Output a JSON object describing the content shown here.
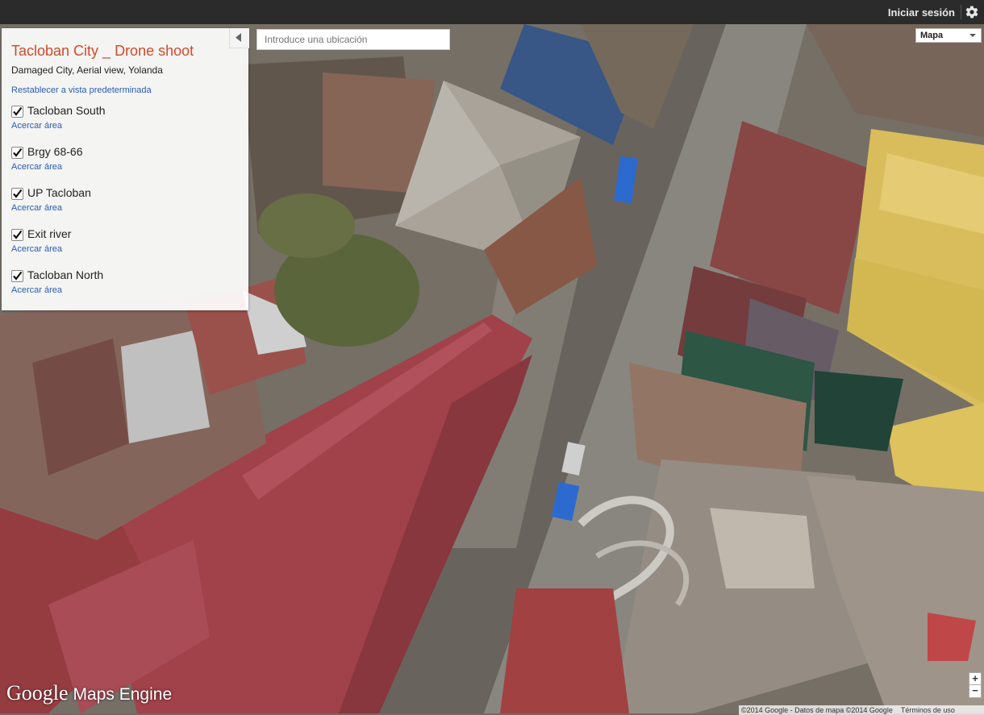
{
  "topbar": {
    "signin_label": "Iniciar sesión",
    "settings_icon": "gear-icon"
  },
  "panel": {
    "title": "Tacloban City _ Drone shoot",
    "subtitle": "Damaged City, Aerial view, Yolanda",
    "reset_link": "Restablecer a vista predeterminada",
    "collapse_icon": "chevron-left-icon",
    "layers": [
      {
        "name": "Tacloban South",
        "checked": true,
        "zoom_label": "Acercar área"
      },
      {
        "name": "Brgy 68-66",
        "checked": true,
        "zoom_label": "Acercar área"
      },
      {
        "name": "UP Tacloban",
        "checked": true,
        "zoom_label": "Acercar área"
      },
      {
        "name": "Exit river",
        "checked": true,
        "zoom_label": "Acercar área"
      },
      {
        "name": "Tacloban North",
        "checked": true,
        "zoom_label": "Acercar área"
      }
    ]
  },
  "search": {
    "placeholder": "Introduce una ubicación"
  },
  "map_type": {
    "selected": "Mapa"
  },
  "zoom": {
    "in_label": "+",
    "out_label": "−"
  },
  "branding": {
    "logo_google": "Google",
    "logo_product": "Maps Engine"
  },
  "attribution": {
    "copyright": "©2014 Google - Datos de mapa ©2014 Google",
    "terms": "Términos de uso"
  },
  "colors": {
    "title_accent": "#d14a2a",
    "link": "#2a5db0",
    "topbar_bg": "#2b2b2b"
  }
}
